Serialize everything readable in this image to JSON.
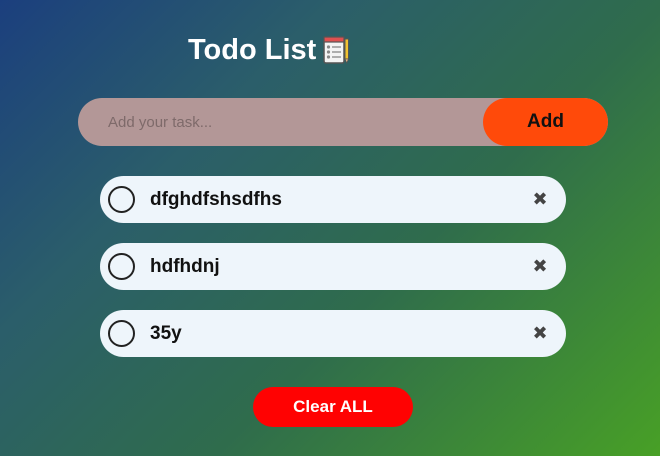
{
  "header": {
    "title": "Todo List",
    "icon": "notepad-icon"
  },
  "input": {
    "placeholder": "Add your task...",
    "value": "",
    "add_label": "Add"
  },
  "tasks": [
    {
      "text": "dfghdfshsdfhs",
      "checked": false
    },
    {
      "text": "hdfhdnj",
      "checked": false
    },
    {
      "text": "35y",
      "checked": false
    }
  ],
  "remove_symbol": "✖",
  "clear_label": "Clear ALL",
  "colors": {
    "add_button": "#ff4a0a",
    "clear_button": "#ff0202",
    "input_bg": "#b39797",
    "task_bg": "#eef5fb"
  }
}
